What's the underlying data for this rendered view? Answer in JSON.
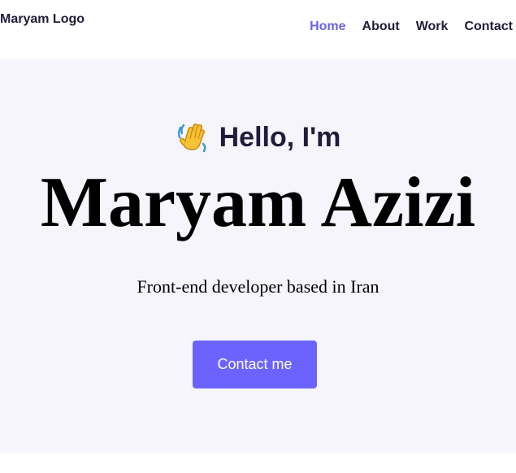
{
  "header": {
    "logo_text": "Maryam Logo",
    "nav": [
      {
        "label": "Home",
        "active": true
      },
      {
        "label": "About",
        "active": false
      },
      {
        "label": "Work",
        "active": false
      },
      {
        "label": "Contact",
        "active": false
      }
    ]
  },
  "hero": {
    "greeting_icon": "waving-hand-icon",
    "greeting": "Hello, I'm",
    "name": "Maryam Azizi",
    "tagline": "Front-end developer based in Iran",
    "cta_label": "Contact me"
  },
  "colors": {
    "accent": "#6c63ff",
    "nav_active": "#6c63e6",
    "text_dark": "#1f1d3a",
    "hero_bg": "#f7f5fc"
  }
}
